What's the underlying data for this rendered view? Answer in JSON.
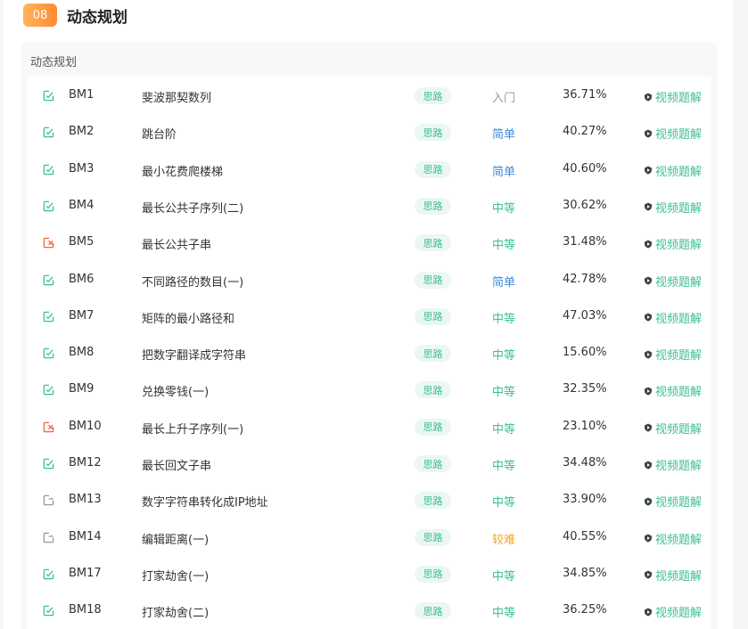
{
  "section": {
    "number": "08",
    "title": "动态规划",
    "panel_title": "动态规划"
  },
  "colors": {
    "solved": "#3fbf8f",
    "wrong": "#f2623b",
    "untried": "#999999",
    "diff_intro": "#999999",
    "diff_easy": "#3d8bd9",
    "diff_medium": "#3fbf8f",
    "diff_hard": "#f5a623"
  },
  "rows": [
    {
      "status": "solved",
      "status_icon": "check-square-icon",
      "code": "BM1",
      "name": "斐波那契数列",
      "tag": "思路",
      "difficulty": "入门",
      "diff_level": "intro",
      "rate": "36.71%",
      "video": "视频题解"
    },
    {
      "status": "solved",
      "status_icon": "check-square-icon",
      "code": "BM2",
      "name": "跳台阶",
      "tag": "思路",
      "difficulty": "简单",
      "diff_level": "easy",
      "rate": "40.27%",
      "video": "视频题解"
    },
    {
      "status": "solved",
      "status_icon": "check-square-icon",
      "code": "BM3",
      "name": "最小花费爬楼梯",
      "tag": "思路",
      "difficulty": "简单",
      "diff_level": "easy",
      "rate": "40.60%",
      "video": "视频题解"
    },
    {
      "status": "solved",
      "status_icon": "check-square-icon",
      "code": "BM4",
      "name": "最长公共子序列(二)",
      "tag": "思路",
      "difficulty": "中等",
      "diff_level": "medium",
      "rate": "30.62%",
      "video": "视频题解"
    },
    {
      "status": "wrong",
      "status_icon": "cross-square-icon",
      "code": "BM5",
      "name": "最长公共子串",
      "tag": "思路",
      "difficulty": "中等",
      "diff_level": "medium",
      "rate": "31.48%",
      "video": "视频题解"
    },
    {
      "status": "solved",
      "status_icon": "check-square-icon",
      "code": "BM6",
      "name": "不同路径的数目(一)",
      "tag": "思路",
      "difficulty": "简单",
      "diff_level": "easy",
      "rate": "42.78%",
      "video": "视频题解"
    },
    {
      "status": "solved",
      "status_icon": "check-square-icon",
      "code": "BM7",
      "name": "矩阵的最小路径和",
      "tag": "思路",
      "difficulty": "中等",
      "diff_level": "medium",
      "rate": "47.03%",
      "video": "视频题解"
    },
    {
      "status": "solved",
      "status_icon": "check-square-icon",
      "code": "BM8",
      "name": "把数字翻译成字符串",
      "tag": "思路",
      "difficulty": "中等",
      "diff_level": "medium",
      "rate": "15.60%",
      "video": "视频题解"
    },
    {
      "status": "solved",
      "status_icon": "check-square-icon",
      "code": "BM9",
      "name": "兑换零钱(一)",
      "tag": "思路",
      "difficulty": "中等",
      "diff_level": "medium",
      "rate": "32.35%",
      "video": "视频题解"
    },
    {
      "status": "wrong",
      "status_icon": "cross-square-icon",
      "code": "BM10",
      "name": "最长上升子序列(一)",
      "tag": "思路",
      "difficulty": "中等",
      "diff_level": "medium",
      "rate": "23.10%",
      "video": "视频题解"
    },
    {
      "status": "solved",
      "status_icon": "check-square-icon",
      "code": "BM12",
      "name": "最长回文子串",
      "tag": "思路",
      "difficulty": "中等",
      "diff_level": "medium",
      "rate": "34.48%",
      "video": "视频题解"
    },
    {
      "status": "untried",
      "status_icon": "pen-square-icon",
      "code": "BM13",
      "name": "数字字符串转化成IP地址",
      "tag": "思路",
      "difficulty": "中等",
      "diff_level": "medium",
      "rate": "33.90%",
      "video": "视频题解"
    },
    {
      "status": "untried",
      "status_icon": "pen-square-icon",
      "code": "BM14",
      "name": "编辑距离(一)",
      "tag": "思路",
      "difficulty": "较难",
      "diff_level": "hard",
      "rate": "40.55%",
      "video": "视频题解"
    },
    {
      "status": "solved",
      "status_icon": "check-square-icon",
      "code": "BM17",
      "name": "打家劫舍(一)",
      "tag": "思路",
      "difficulty": "中等",
      "diff_level": "medium",
      "rate": "34.85%",
      "video": "视频题解"
    },
    {
      "status": "solved",
      "status_icon": "check-square-icon",
      "code": "BM18",
      "name": "打家劫舍(二)",
      "tag": "思路",
      "difficulty": "中等",
      "diff_level": "medium",
      "rate": "36.25%",
      "video": "视频题解"
    }
  ]
}
